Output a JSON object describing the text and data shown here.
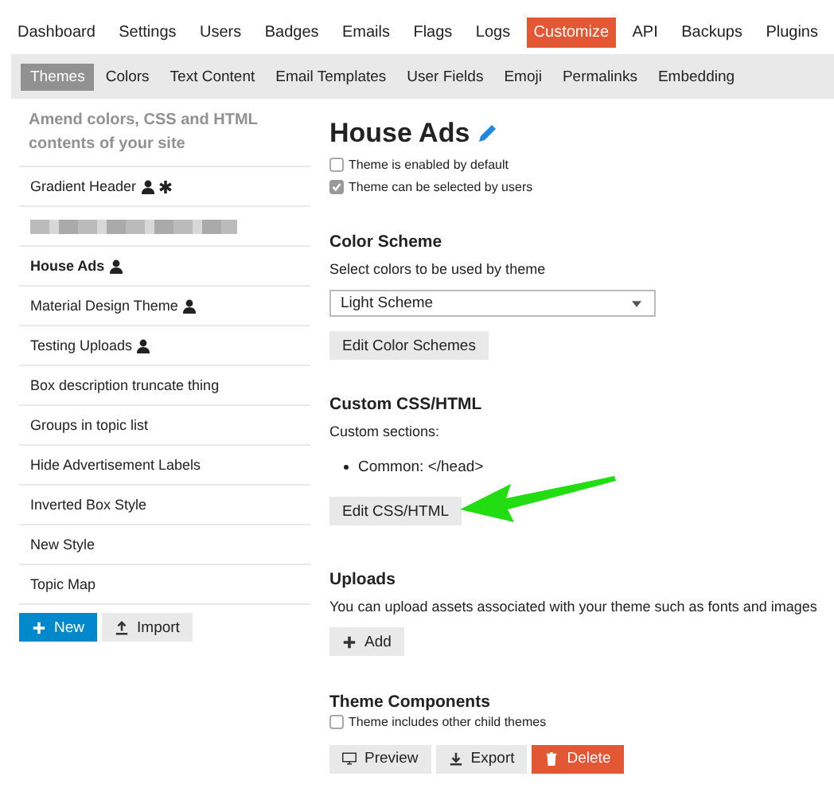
{
  "top_nav": [
    {
      "label": "Dashboard",
      "selected": false
    },
    {
      "label": "Settings",
      "selected": false
    },
    {
      "label": "Users",
      "selected": false
    },
    {
      "label": "Badges",
      "selected": false
    },
    {
      "label": "Emails",
      "selected": false
    },
    {
      "label": "Flags",
      "selected": false
    },
    {
      "label": "Logs",
      "selected": false
    },
    {
      "label": "Customize",
      "selected": true
    },
    {
      "label": "API",
      "selected": false
    },
    {
      "label": "Backups",
      "selected": false
    },
    {
      "label": "Plugins",
      "selected": false
    }
  ],
  "sub_nav": [
    {
      "label": "Themes",
      "selected": true
    },
    {
      "label": "Colors",
      "selected": false
    },
    {
      "label": "Text Content",
      "selected": false
    },
    {
      "label": "Email Templates",
      "selected": false
    },
    {
      "label": "User Fields",
      "selected": false
    },
    {
      "label": "Emoji",
      "selected": false
    },
    {
      "label": "Permalinks",
      "selected": false
    },
    {
      "label": "Embedding",
      "selected": false
    }
  ],
  "sidebar": {
    "description": "Amend colors, CSS and HTML contents of your site",
    "items": [
      {
        "kind": "theme",
        "name": "Gradient Header",
        "user_selectable": true,
        "default": true,
        "selected": false
      },
      {
        "kind": "redacted"
      },
      {
        "kind": "theme",
        "name": "House Ads",
        "user_selectable": true,
        "default": false,
        "selected": true
      },
      {
        "kind": "theme",
        "name": "Material Design Theme",
        "user_selectable": true,
        "default": false,
        "selected": false
      },
      {
        "kind": "theme",
        "name": "Testing Uploads",
        "user_selectable": true,
        "default": false,
        "selected": false
      },
      {
        "kind": "theme",
        "name": "Box description truncate thing",
        "user_selectable": false,
        "default": false,
        "selected": false
      },
      {
        "kind": "theme",
        "name": "Groups in topic list",
        "user_selectable": false,
        "default": false,
        "selected": false
      },
      {
        "kind": "theme",
        "name": "Hide Advertisement Labels",
        "user_selectable": false,
        "default": false,
        "selected": false
      },
      {
        "kind": "theme",
        "name": "Inverted Box Style",
        "user_selectable": false,
        "default": false,
        "selected": false
      },
      {
        "kind": "theme",
        "name": "New Style",
        "user_selectable": false,
        "default": false,
        "selected": false
      },
      {
        "kind": "theme",
        "name": "Topic Map",
        "user_selectable": false,
        "default": false,
        "selected": false
      }
    ],
    "buttons": [
      {
        "kind": "new",
        "label": "New"
      },
      {
        "kind": "import",
        "label": "Import"
      }
    ]
  },
  "detail": {
    "title": "House Ads",
    "options": [
      {
        "label": "Theme is enabled by default",
        "checked": false
      },
      {
        "label": "Theme can be selected by users",
        "checked": true
      }
    ],
    "color_scheme": {
      "heading": "Color Scheme",
      "description": "Select colors to be used by theme",
      "value": "Light Scheme",
      "button": "Edit Color Schemes"
    },
    "custom_css": {
      "heading": "Custom CSS/HTML",
      "description": "Custom sections:",
      "sections": [
        "Common: </head>"
      ],
      "button": "Edit CSS/HTML"
    },
    "uploads": {
      "heading": "Uploads",
      "description": "You can upload assets associated with your theme such as fonts and images",
      "button": "Add"
    },
    "components": {
      "heading": "Theme Components",
      "option": {
        "label": "Theme includes other child themes",
        "checked": false
      }
    },
    "actions": [
      {
        "kind": "preview",
        "label": "Preview"
      },
      {
        "kind": "export",
        "label": "Export"
      },
      {
        "kind": "delete",
        "label": "Delete"
      }
    ]
  }
}
